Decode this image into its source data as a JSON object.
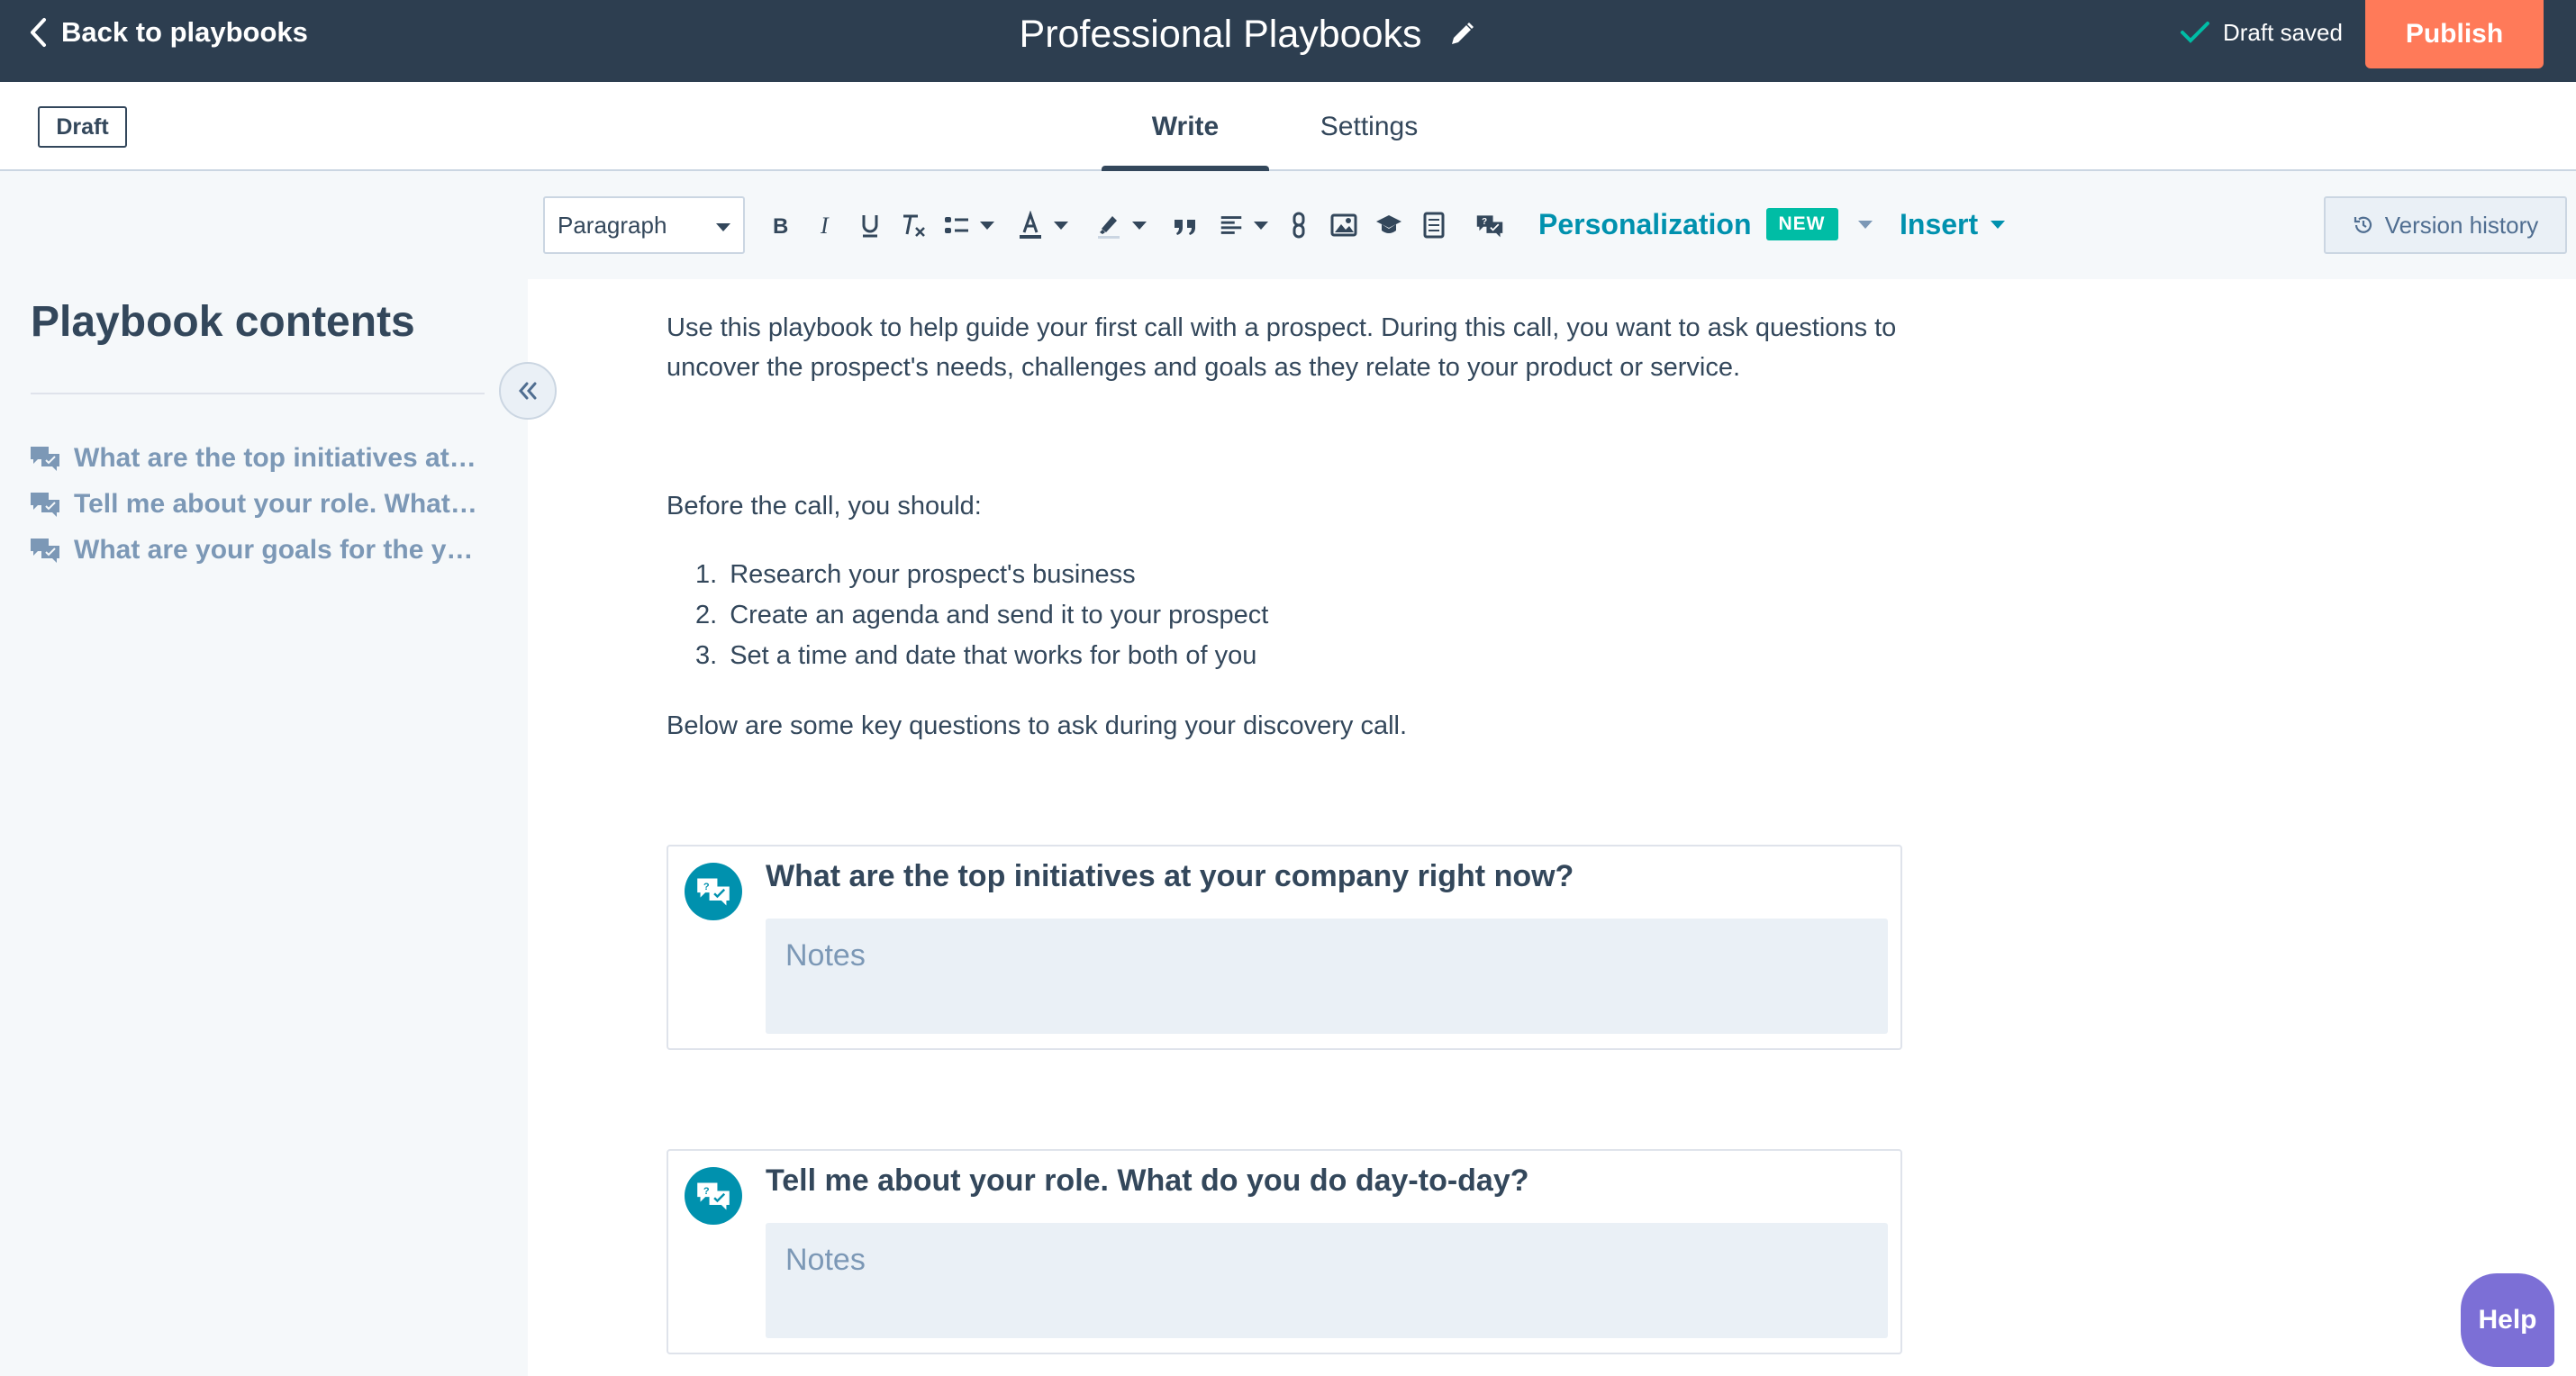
{
  "header": {
    "back_label": "Back to playbooks",
    "title": "Professional Playbooks",
    "save_status": "Draft saved",
    "publish_label": "Publish"
  },
  "tabbar": {
    "status_badge": "Draft",
    "tabs": [
      {
        "label": "Write",
        "active": true
      },
      {
        "label": "Settings",
        "active": false
      }
    ]
  },
  "toolbar": {
    "paragraph_style": "Paragraph",
    "personalization_label": "Personalization",
    "new_badge": "NEW",
    "insert_label": "Insert",
    "version_history_label": "Version history",
    "icons": [
      "bold-icon",
      "italic-icon",
      "underline-icon",
      "clear-format-icon",
      "list-icon",
      "text-color-icon",
      "highlight-icon",
      "blockquote-icon",
      "align-icon",
      "link-icon",
      "image-icon",
      "video-icon",
      "document-icon",
      "question-icon"
    ]
  },
  "sidebar": {
    "title": "Playbook contents",
    "items": [
      {
        "label": "What are the top initiatives at your company right now?"
      },
      {
        "label": "Tell me about your role. What do you do day-to-day?"
      },
      {
        "label": "What are your goals for the year?"
      }
    ]
  },
  "editor": {
    "intro_line1": "Use this playbook to help guide your first call with a prospect. During this call, you want to ask questions to",
    "intro_line2": "uncover the prospect's needs, challenges and goals as they relate to your product or service.",
    "before_call": "Before the call, you should:",
    "steps": [
      "Research your prospect's business",
      "Create an agenda and send it to your prospect",
      "Set a time and date that works for both of you"
    ],
    "below_text": "Below are some key questions to ask during your discovery call.",
    "questions": [
      {
        "title": "What are the top initiatives at your company right now?",
        "notes_placeholder": "Notes"
      },
      {
        "title": "Tell me about your role. What do you do day-to-day?",
        "notes_placeholder": "Notes"
      }
    ]
  },
  "help_label": "Help",
  "colors": {
    "header_bg": "#2d3e50",
    "publish": "#ff7a59",
    "accent": "#0091ae",
    "new_badge": "#00bda5",
    "help": "#7c6fd6"
  }
}
